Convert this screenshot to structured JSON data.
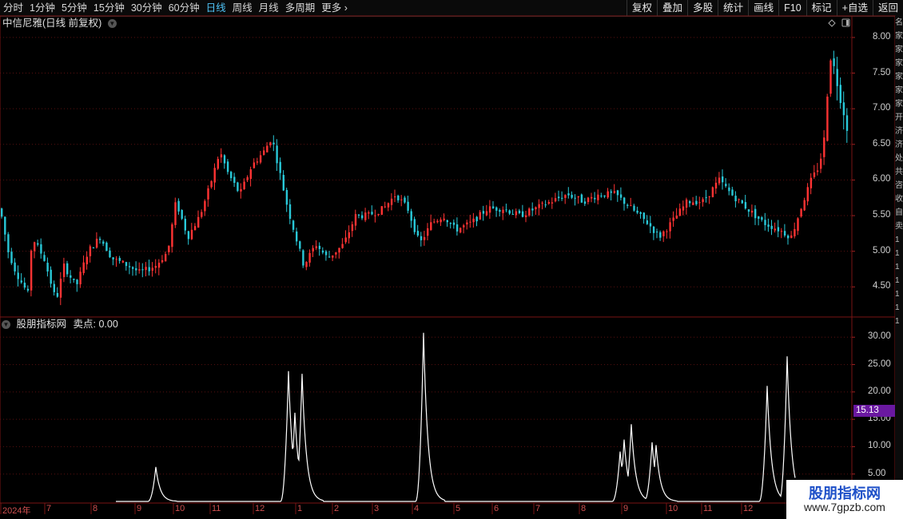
{
  "toolbar": {
    "tabs": [
      "分时",
      "1分钟",
      "5分钟",
      "15分钟",
      "30分钟",
      "60分钟",
      "日线",
      "周线",
      "月线",
      "多周期",
      "更多"
    ],
    "active_tab": "日线",
    "right_buttons": [
      "复权",
      "叠加",
      "多股",
      "统计",
      "画线",
      "F10",
      "标记",
      "+自选",
      "返回"
    ]
  },
  "main_chart": {
    "title": "中信尼雅(日线 前复权)",
    "y_ticks": [
      "8.00",
      "7.50",
      "7.00",
      "6.50",
      "6.00",
      "5.50",
      "5.00",
      "4.50"
    ],
    "up_color": "#ff3333",
    "down_color": "#29c8d8"
  },
  "indicator": {
    "title": "股朋指标网",
    "label": "卖点:",
    "value": "0.00",
    "y_ticks": [
      "30.00",
      "25.00",
      "20.00",
      "15.00",
      "10.00",
      "5.00"
    ],
    "current_value_tag": "15.13",
    "tag_color": "#6a18a0"
  },
  "x_axis": {
    "labels": [
      "2024年",
      "7",
      "8",
      "9",
      "10",
      "11",
      "12",
      "1",
      "2",
      "3",
      "4",
      "5",
      "6",
      "7",
      "8",
      "9",
      "10",
      "11",
      "12"
    ]
  },
  "watermark": {
    "title": "股朋指标网",
    "url": "www.7gpzb.com"
  },
  "right_strip": [
    "名",
    "家",
    "家",
    "家",
    "家",
    "家",
    "家",
    "开",
    "济",
    "济",
    "处",
    "共",
    "咨",
    "收",
    "自",
    "卖",
    "1",
    "1",
    "1",
    "1",
    "1",
    "1",
    "1"
  ],
  "chart_data": {
    "type": "candlestick",
    "title": "中信尼雅(日线 前复权)",
    "ylim": [
      4.1,
      8.1
    ],
    "price_path_anchors": [
      [
        0,
        5.6
      ],
      [
        10,
        5.0
      ],
      [
        20,
        4.7
      ],
      [
        35,
        4.4
      ],
      [
        40,
        5.2
      ],
      [
        55,
        4.9
      ],
      [
        70,
        4.3
      ],
      [
        80,
        4.8
      ],
      [
        95,
        4.5
      ],
      [
        110,
        5.0
      ],
      [
        125,
        5.2
      ],
      [
        140,
        4.9
      ],
      [
        160,
        4.8
      ],
      [
        175,
        4.7
      ],
      [
        195,
        4.8
      ],
      [
        210,
        5.0
      ],
      [
        220,
        5.7
      ],
      [
        235,
        5.2
      ],
      [
        250,
        5.5
      ],
      [
        262,
        5.9
      ],
      [
        275,
        6.4
      ],
      [
        285,
        6.1
      ],
      [
        300,
        5.8
      ],
      [
        315,
        6.2
      ],
      [
        330,
        6.4
      ],
      [
        340,
        6.6
      ],
      [
        350,
        6.1
      ],
      [
        360,
        5.6
      ],
      [
        370,
        5.2
      ],
      [
        380,
        4.8
      ],
      [
        395,
        5.1
      ],
      [
        410,
        4.9
      ],
      [
        430,
        5.1
      ],
      [
        445,
        5.5
      ],
      [
        460,
        5.5
      ],
      [
        480,
        5.6
      ],
      [
        495,
        5.8
      ],
      [
        510,
        5.6
      ],
      [
        525,
        5.1
      ],
      [
        540,
        5.4
      ],
      [
        555,
        5.5
      ],
      [
        570,
        5.3
      ],
      [
        590,
        5.4
      ],
      [
        610,
        5.6
      ],
      [
        630,
        5.6
      ],
      [
        650,
        5.5
      ],
      [
        670,
        5.6
      ],
      [
        690,
        5.7
      ],
      [
        710,
        5.8
      ],
      [
        730,
        5.7
      ],
      [
        750,
        5.8
      ],
      [
        770,
        5.8
      ],
      [
        790,
        5.6
      ],
      [
        810,
        5.4
      ],
      [
        825,
        5.2
      ],
      [
        840,
        5.4
      ],
      [
        860,
        5.7
      ],
      [
        880,
        5.7
      ],
      [
        900,
        6.0
      ],
      [
        915,
        5.8
      ],
      [
        935,
        5.6
      ],
      [
        955,
        5.4
      ],
      [
        975,
        5.3
      ],
      [
        990,
        5.2
      ],
      [
        1005,
        5.7
      ],
      [
        1015,
        6.0
      ],
      [
        1025,
        6.2
      ],
      [
        1032,
        6.6
      ],
      [
        1038,
        7.8
      ],
      [
        1045,
        7.5
      ],
      [
        1055,
        7.0
      ],
      [
        1060,
        6.75
      ]
    ],
    "indicator_series": {
      "name": "卖点",
      "peaks": [
        {
          "x": 195,
          "h": 6.3
        },
        {
          "x": 361,
          "h": 23.8
        },
        {
          "x": 369,
          "h": 16.2
        },
        {
          "x": 378,
          "h": 23.3
        },
        {
          "x": 530,
          "h": 30.8
        },
        {
          "x": 776,
          "h": 9.1
        },
        {
          "x": 781,
          "h": 11.3
        },
        {
          "x": 790,
          "h": 14.1
        },
        {
          "x": 816,
          "h": 10.8
        },
        {
          "x": 821,
          "h": 10.3
        },
        {
          "x": 960,
          "h": 21.1
        },
        {
          "x": 985,
          "h": 26.5
        }
      ],
      "ylim": [
        0,
        31.5
      ]
    }
  }
}
